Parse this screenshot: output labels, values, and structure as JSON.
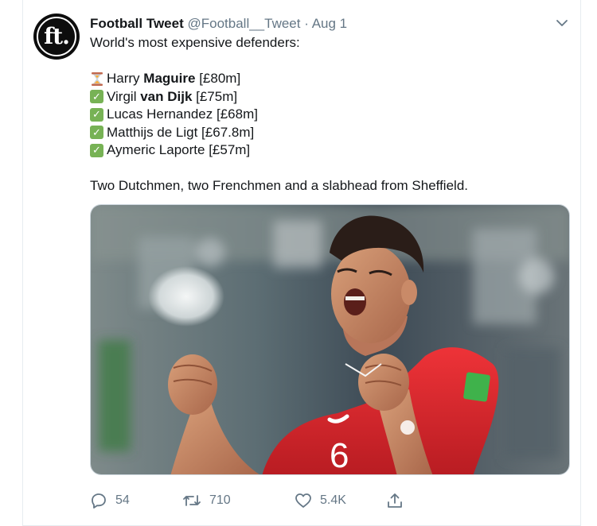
{
  "tweet": {
    "display_name": "Football Tweet",
    "handle": "@Football__Tweet",
    "separator": "·",
    "date": "Aug 1",
    "avatar_text": "ft.",
    "headline": "World's most expensive defenders:",
    "list": [
      {
        "icon": "hourglass-icon",
        "text_pre": "Harry ",
        "text_bold": "Maguire",
        "text_post": " [£80m]"
      },
      {
        "icon": "check-mark-icon",
        "text_pre": "Virgil ",
        "text_bold": "van Dijk",
        "text_post": " [£75m]"
      },
      {
        "icon": "check-mark-icon",
        "text_pre": "Lucas Hernandez [£68m]",
        "text_bold": "",
        "text_post": ""
      },
      {
        "icon": "check-mark-icon",
        "text_pre": "Matthijs de Ligt [£67.8m]",
        "text_bold": "",
        "text_post": ""
      },
      {
        "icon": "check-mark-icon",
        "text_pre": "Aymeric Laporte [£57m]",
        "text_bold": "",
        "text_post": ""
      }
    ],
    "closing": "Two Dutchmen, two Frenchmen and a slabhead from Sheffield.",
    "jersey_number": "6"
  },
  "actions": {
    "replies": "54",
    "retweets": "710",
    "likes": "5.4K"
  },
  "colors": {
    "text": "#14171a",
    "secondary": "#657786",
    "check_green": "#77b255",
    "jersey_red": "#e0262d"
  }
}
